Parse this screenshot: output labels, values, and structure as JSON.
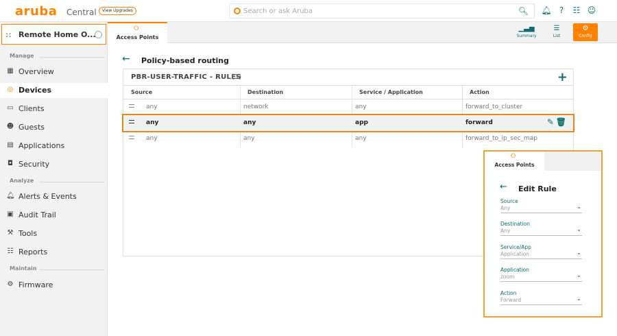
{
  "header": {
    "logo": "aruba",
    "logo_sub": "Central",
    "upgrade_label": "View Upgrades",
    "search_placeholder": "Search or ask Aruba"
  },
  "sidebar": {
    "site_name": "Remote Home O...",
    "sections": {
      "manage": "Manage",
      "analyze": "Analyze",
      "maintain": "Maintain"
    },
    "items": [
      {
        "label": "Overview",
        "icon": "grid-icon"
      },
      {
        "label": "Devices",
        "icon": "devices-icon",
        "active": true
      },
      {
        "label": "Clients",
        "icon": "clients-icon"
      },
      {
        "label": "Guests",
        "icon": "guests-icon"
      },
      {
        "label": "Applications",
        "icon": "applications-icon"
      },
      {
        "label": "Security",
        "icon": "security-icon"
      },
      {
        "label": "Alerts & Events",
        "icon": "bell-icon"
      },
      {
        "label": "Audit Trail",
        "icon": "audit-icon"
      },
      {
        "label": "Tools",
        "icon": "tools-icon"
      },
      {
        "label": "Reports",
        "icon": "reports-icon"
      },
      {
        "label": "Firmware",
        "icon": "firmware-icon"
      }
    ]
  },
  "context": {
    "tab_label": "Access Points",
    "views": {
      "summary": "Summary",
      "list": "List",
      "config": "Config"
    }
  },
  "main": {
    "title": "Policy-based routing",
    "panel_title": "PBR-USER-TRAFFIC - RULES",
    "panel_count": "(3)",
    "columns": [
      "Source",
      "Destination",
      "Service / Application",
      "Action"
    ],
    "rows": [
      {
        "source": "any",
        "destination": "network",
        "service": "any",
        "action": "forward_to_cluster"
      },
      {
        "source": "any",
        "destination": "any",
        "service": "app",
        "action": "forward"
      },
      {
        "source": "any",
        "destination": "any",
        "service": "any",
        "action": "forward_to_ip_sec_map"
      }
    ]
  },
  "edit_rule": {
    "tab_label": "Access Points",
    "title": "Edit Rule",
    "fields": [
      {
        "label": "Source",
        "value": "Any"
      },
      {
        "label": "Destination",
        "value": "Any"
      },
      {
        "label": "Service/App",
        "value": "Application"
      },
      {
        "label": "Application",
        "value": "zoom"
      },
      {
        "label": "Action",
        "value": "Forward"
      }
    ]
  },
  "colors": {
    "brand_orange": "#ff8300",
    "accent_teal": "#0c6e6e"
  }
}
